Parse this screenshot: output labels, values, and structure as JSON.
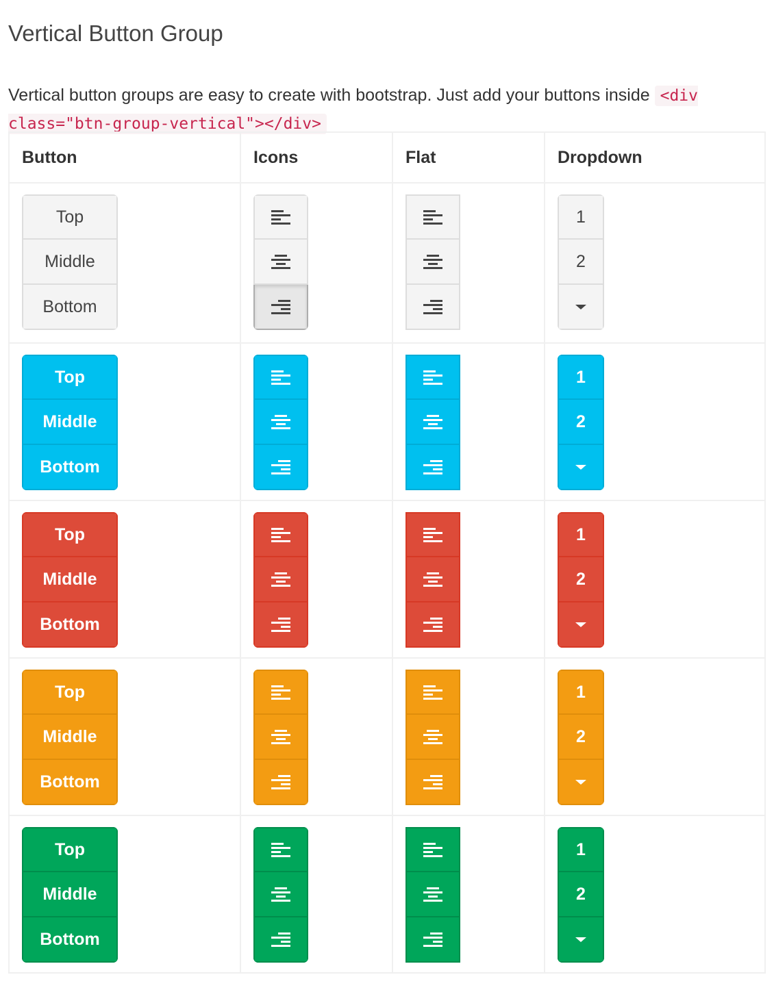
{
  "page": {
    "title": "Vertical Button Group",
    "description_text": "Vertical button groups are easy to create with bootstrap. Just add your buttons inside ",
    "description_code": "<div class=\"btn-group-vertical\"></div>"
  },
  "table": {
    "headers": [
      "Button",
      "Icons",
      "Flat",
      "Dropdown"
    ],
    "button_labels": [
      "Top",
      "Middle",
      "Bottom"
    ],
    "icon_names": [
      "align-left-icon",
      "align-center-icon",
      "align-right-icon"
    ],
    "dropdown_labels": [
      "1",
      "2"
    ],
    "dropdown_caret_icon": "caret-down-icon",
    "rows": [
      {
        "style": "default",
        "color": "#f4f4f4",
        "active_icon_index": 2
      },
      {
        "style": "info",
        "color": "#00c0ef"
      },
      {
        "style": "danger",
        "color": "#dd4b39"
      },
      {
        "style": "warning",
        "color": "#f39c12"
      },
      {
        "style": "success",
        "color": "#00a65a"
      }
    ]
  }
}
